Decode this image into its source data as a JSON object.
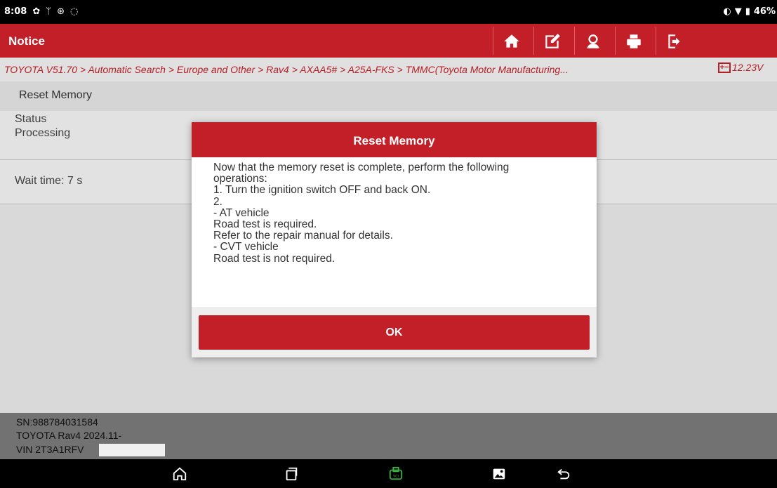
{
  "status_bar": {
    "time": "8:08",
    "left_icons": [
      "gear-icon",
      "usb-icon",
      "bluetooth-icon",
      "chat-icon"
    ],
    "battery": "46%"
  },
  "header": {
    "title": "Notice",
    "buttons": [
      "home-icon",
      "edit-icon",
      "support-icon",
      "print-icon",
      "exit-icon"
    ]
  },
  "breadcrumb": {
    "path": "TOYOTA V51.70 > Automatic Search > Europe and Other > Rav4 > AXAA5# > A25A-FKS > TMMC(Toyota Motor Manufacturing...",
    "voltage": "12.23V"
  },
  "main": {
    "section_title": "Reset Memory",
    "status_label": "Status",
    "status_value": "Processing",
    "wait_label": "Wait time: 7 s"
  },
  "dialog": {
    "title": "Reset Memory",
    "lines": [
      "Now that the memory reset is complete, perform the following",
      "operations:",
      "1. Turn the ignition switch OFF and back ON.",
      "2.",
      "- AT vehicle",
      "Road test is required.",
      "Refer to the repair manual for details.",
      "- CVT vehicle",
      "Road test is not required."
    ],
    "ok_label": "OK"
  },
  "footer": {
    "sn": "SN:988784031584",
    "vehicle": "TOYOTA Rav4 2024.11-",
    "vin": "VIN 2T3A1RFV"
  },
  "nav": {
    "accent": "#3cb043",
    "icons": [
      "home-nav-icon",
      "recents-icon",
      "vci-icon",
      "gallery-icon",
      "back-icon"
    ]
  }
}
